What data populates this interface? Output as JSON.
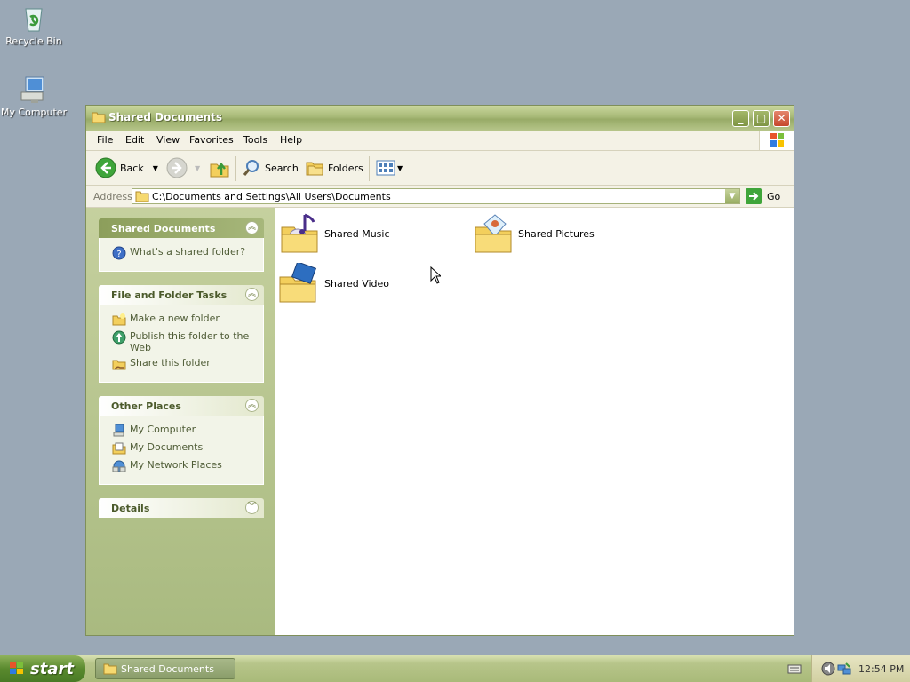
{
  "desktop": {
    "icons": [
      {
        "label": "Recycle Bin",
        "icon": "recycle-bin-icon"
      },
      {
        "label": "My Computer",
        "icon": "my-computer-icon"
      }
    ]
  },
  "window": {
    "title": "Shared Documents",
    "menu": [
      "File",
      "Edit",
      "View",
      "Favorites",
      "Tools",
      "Help"
    ],
    "toolbar": {
      "back": "Back",
      "search": "Search",
      "folders": "Folders"
    },
    "address": {
      "label": "Address",
      "value": "C:\\Documents and Settings\\All Users\\Documents",
      "go": "Go"
    },
    "panels": {
      "shared": {
        "title": "Shared Documents",
        "items": [
          "What's a shared folder?"
        ]
      },
      "tasks": {
        "title": "File and Folder Tasks",
        "items": [
          "Make a new folder",
          "Publish this folder to the Web",
          "Share this folder"
        ]
      },
      "places": {
        "title": "Other Places",
        "items": [
          "My Computer",
          "My Documents",
          "My Network Places"
        ]
      },
      "details": {
        "title": "Details"
      }
    },
    "files": [
      {
        "name": "Shared Music",
        "icon": "music-folder-icon"
      },
      {
        "name": "Shared Pictures",
        "icon": "pictures-folder-icon"
      },
      {
        "name": "Shared Video",
        "icon": "video-folder-icon"
      }
    ]
  },
  "taskbar": {
    "start": "start",
    "task": "Shared Documents",
    "clock": "12:54 PM"
  },
  "colors": {
    "desktop": "#9aa8b6",
    "titlebar": "#a7b977",
    "taskbar": "#b7c58a",
    "panel_text": "#4f5c36"
  }
}
